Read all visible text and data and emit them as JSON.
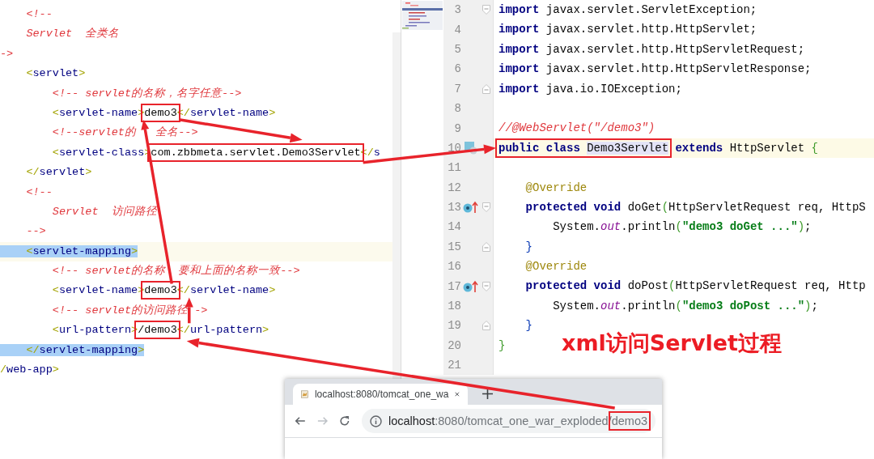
{
  "xml_editor": {
    "lines": [
      {
        "current": false,
        "tokens": [
          {
            "text": "    <!--",
            "kind": "comment"
          }
        ]
      },
      {
        "current": false,
        "tokens": [
          {
            "text": "    Servlet  全类名",
            "kind": "comment"
          }
        ]
      },
      {
        "current": false,
        "tokens": [
          {
            "text": "->",
            "kind": "comment"
          }
        ]
      },
      {
        "current": false,
        "tokens": [
          {
            "text": "    <",
            "kind": "punct"
          },
          {
            "text": "servlet",
            "kind": "tag"
          },
          {
            "text": ">",
            "kind": "punct"
          }
        ]
      },
      {
        "current": false,
        "tokens": [
          {
            "text": "        <!-- servlet的名称，名字任意-->",
            "kind": "comment"
          }
        ]
      },
      {
        "current": false,
        "tokens": [
          {
            "text": "        <",
            "kind": "punct"
          },
          {
            "text": "servlet-name",
            "kind": "tag"
          },
          {
            "text": ">",
            "kind": "punct"
          },
          {
            "text": "demo3",
            "kind": "text",
            "boxed": true
          },
          {
            "text": "</",
            "kind": "punct"
          },
          {
            "text": "servlet-name",
            "kind": "tag"
          },
          {
            "text": ">",
            "kind": "punct"
          }
        ]
      },
      {
        "current": false,
        "tokens": [
          {
            "text": "        <!--servlet的",
            "kind": "comment"
          },
          {
            "text": "   全名-->",
            "kind": "comment"
          }
        ]
      },
      {
        "current": false,
        "tokens": [
          {
            "text": "        <",
            "kind": "punct"
          },
          {
            "text": "servlet-class",
            "kind": "tag"
          },
          {
            "text": ">",
            "kind": "punct"
          },
          {
            "text": "com.zbbmeta.servlet.Demo3Servlet",
            "kind": "text",
            "boxed": true
          },
          {
            "text": "</",
            "kind": "punct"
          },
          {
            "text": "s",
            "kind": "tag"
          }
        ]
      },
      {
        "current": false,
        "tokens": [
          {
            "text": "    </",
            "kind": "punct"
          },
          {
            "text": "servlet",
            "kind": "tag"
          },
          {
            "text": ">",
            "kind": "punct"
          }
        ]
      },
      {
        "current": false,
        "tokens": [
          {
            "text": "    <!--",
            "kind": "comment"
          }
        ]
      },
      {
        "current": false,
        "tokens": [
          {
            "text": "        Servlet  访问路径",
            "kind": "comment"
          }
        ]
      },
      {
        "current": false,
        "tokens": [
          {
            "text": "    -->",
            "kind": "comment"
          }
        ]
      },
      {
        "current": true,
        "tokens": [
          {
            "text": "    <",
            "kind": "punct",
            "highlighted": true
          },
          {
            "text": "servlet-mapping",
            "kind": "tag",
            "highlighted": true
          },
          {
            "text": ">",
            "kind": "punct",
            "highlighted": true
          }
        ]
      },
      {
        "current": false,
        "tokens": [
          {
            "text": "        <!-- servlet的名称",
            "kind": "comment"
          },
          {
            "text": "  要和上面的名称一致-->",
            "kind": "comment"
          }
        ]
      },
      {
        "current": false,
        "tokens": [
          {
            "text": "        <",
            "kind": "punct"
          },
          {
            "text": "servlet-name",
            "kind": "tag"
          },
          {
            "text": ">",
            "kind": "punct"
          },
          {
            "text": "demo3",
            "kind": "text",
            "boxed": true
          },
          {
            "text": "</",
            "kind": "punct"
          },
          {
            "text": "servlet-name",
            "kind": "tag"
          },
          {
            "text": ">",
            "kind": "punct"
          }
        ]
      },
      {
        "current": false,
        "tokens": [
          {
            "text": "        <!-- servlet的访问路径",
            "kind": "comment"
          },
          {
            "text": " ->",
            "kind": "comment"
          }
        ]
      },
      {
        "current": false,
        "tokens": [
          {
            "text": "        <",
            "kind": "punct"
          },
          {
            "text": "url-pattern",
            "kind": "tag"
          },
          {
            "text": ">",
            "kind": "punct"
          },
          {
            "text": "/demo3",
            "kind": "text",
            "boxed": true
          },
          {
            "text": "</",
            "kind": "punct"
          },
          {
            "text": "url-pattern",
            "kind": "tag"
          },
          {
            "text": ">",
            "kind": "punct"
          }
        ]
      },
      {
        "current": false,
        "tokens": [
          {
            "text": "    </",
            "kind": "punct",
            "highlighted": true
          },
          {
            "text": "servlet-mapping",
            "kind": "tag",
            "highlighted": true
          },
          {
            "text": ">",
            "kind": "punct",
            "highlighted": true
          }
        ]
      },
      {
        "current": false,
        "tokens": [
          {
            "text": "/",
            "kind": "punct"
          },
          {
            "text": "web-app",
            "kind": "tag"
          },
          {
            "text": ">",
            "kind": "punct"
          }
        ]
      }
    ]
  },
  "java_editor": {
    "lines": [
      {
        "number": "3",
        "current": false,
        "fold": {
          "kind": "start"
        },
        "tokens": [
          {
            "text": "import",
            "kind": "keyword"
          },
          {
            "text": " javax.servlet.ServletException;",
            "kind": "plain"
          }
        ]
      },
      {
        "number": "4",
        "current": false,
        "tokens": [
          {
            "text": "import",
            "kind": "keyword"
          },
          {
            "text": " javax.servlet.http.HttpServlet;",
            "kind": "plain"
          }
        ]
      },
      {
        "number": "5",
        "current": false,
        "tokens": [
          {
            "text": "import",
            "kind": "keyword"
          },
          {
            "text": " javax.servlet.http.HttpServletRequest;",
            "kind": "plain"
          }
        ]
      },
      {
        "number": "6",
        "current": false,
        "tokens": [
          {
            "text": "import",
            "kind": "keyword"
          },
          {
            "text": " javax.servlet.http.HttpServletResponse;",
            "kind": "plain"
          }
        ]
      },
      {
        "number": "7",
        "current": false,
        "fold": {
          "kind": "end"
        },
        "tokens": [
          {
            "text": "import",
            "kind": "keyword"
          },
          {
            "text": " java.io.IOException;",
            "kind": "plain"
          }
        ]
      },
      {
        "number": "8",
        "current": false
      },
      {
        "number": "9",
        "current": false,
        "tokens": [
          {
            "text": "//@WebServlet(\"/demo3\")",
            "kind": "comment"
          }
        ]
      },
      {
        "number": "10",
        "current": true,
        "marker": {
          "kind": "implements"
        },
        "tokens": [
          {
            "kind": "group",
            "boxed": true,
            "tokens": [
              {
                "text": "public class ",
                "kind": "keyword"
              },
              {
                "text": "Demo3Servlet",
                "kind": "plain",
                "highlighted": true
              }
            ]
          },
          {
            "text": " extends ",
            "kind": "keyword"
          },
          {
            "text": "HttpServlet ",
            "kind": "plain"
          },
          {
            "text": "{",
            "kind": "paren"
          }
        ]
      },
      {
        "number": "11",
        "current": false
      },
      {
        "number": "12",
        "current": false,
        "tokens": [
          {
            "text": "    @Override",
            "kind": "annotation"
          }
        ]
      },
      {
        "number": "13",
        "current": false,
        "marker": {
          "kind": "override"
        },
        "fold": {
          "kind": "start"
        },
        "tokens": [
          {
            "text": "    protected void ",
            "kind": "keyword"
          },
          {
            "text": "doGet",
            "kind": "plain"
          },
          {
            "text": "(",
            "kind": "paren"
          },
          {
            "text": "HttpServletRequest req, HttpS",
            "kind": "plain"
          }
        ]
      },
      {
        "number": "14",
        "current": false,
        "tokens": [
          {
            "text": "        System.",
            "kind": "plain"
          },
          {
            "text": "out",
            "kind": "static"
          },
          {
            "text": ".println",
            "kind": "plain"
          },
          {
            "text": "(",
            "kind": "paren"
          },
          {
            "text": "\"demo3 doGet ...\"",
            "kind": "string"
          },
          {
            "text": ")",
            "kind": "paren"
          },
          {
            "text": ";",
            "kind": "plain"
          }
        ]
      },
      {
        "number": "15",
        "current": false,
        "fold": {
          "kind": "end"
        },
        "tokens": [
          {
            "text": "    }",
            "kind": "brace"
          }
        ]
      },
      {
        "number": "16",
        "current": false,
        "tokens": [
          {
            "text": "    @Override",
            "kind": "annotation"
          }
        ]
      },
      {
        "number": "17",
        "current": false,
        "marker": {
          "kind": "override"
        },
        "fold": {
          "kind": "start"
        },
        "tokens": [
          {
            "text": "    protected void ",
            "kind": "keyword"
          },
          {
            "text": "doPost",
            "kind": "plain"
          },
          {
            "text": "(",
            "kind": "paren"
          },
          {
            "text": "HttpServletRequest req, Http",
            "kind": "plain"
          }
        ]
      },
      {
        "number": "18",
        "current": false,
        "tokens": [
          {
            "text": "        System.",
            "kind": "plain"
          },
          {
            "text": "out",
            "kind": "static"
          },
          {
            "text": ".println",
            "kind": "plain"
          },
          {
            "text": "(",
            "kind": "paren"
          },
          {
            "text": "\"demo3 doPost ...\"",
            "kind": "string"
          },
          {
            "text": ")",
            "kind": "paren"
          },
          {
            "text": ";",
            "kind": "plain"
          }
        ]
      },
      {
        "number": "19",
        "current": false,
        "fold": {
          "kind": "end"
        },
        "tokens": [
          {
            "text": "    }",
            "kind": "brace"
          }
        ]
      },
      {
        "number": "20",
        "current": false,
        "tokens": [
          {
            "text": "}",
            "kind": "paren"
          }
        ]
      },
      {
        "number": "21",
        "current": false
      }
    ]
  },
  "caption": "xml访问Servlet过程",
  "browser": {
    "tabs": [
      {
        "title": "localhost:8080/tomcat_one_wa",
        "selected": true
      }
    ],
    "back": {
      "disabled": false
    },
    "forward": {
      "disabled": true
    },
    "address": {
      "tokens": [
        {
          "text": "localhost",
          "kind": "host"
        },
        {
          "text": ":8080/tomcat_one_war_exploded/",
          "kind": "path"
        },
        {
          "text": "demo3",
          "kind": "path",
          "boxed": true
        }
      ]
    }
  }
}
